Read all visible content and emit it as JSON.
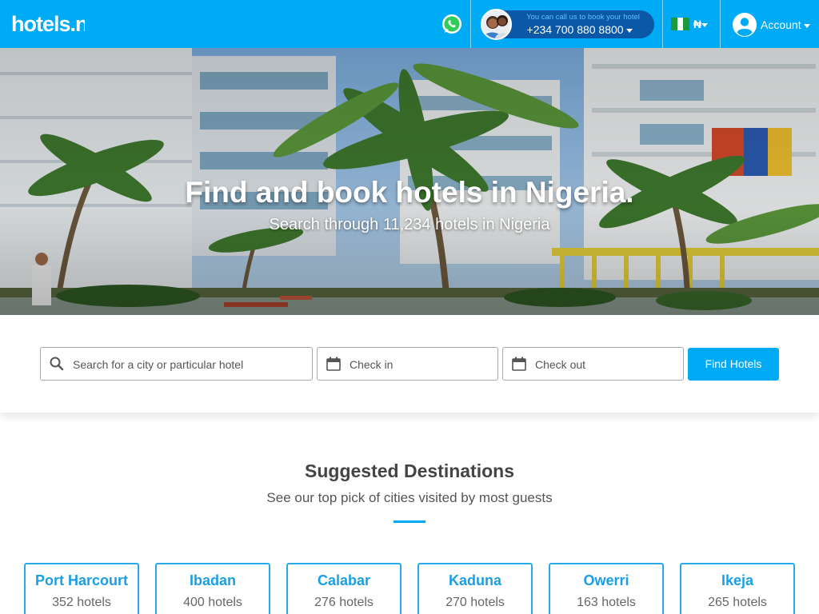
{
  "header": {
    "logo_text": "hotels.ng",
    "whatsapp_icon": "whatsapp-icon",
    "call_prompt": "You can call us to book your hotel",
    "phone": "+234 700 880 8800",
    "currency": "₦",
    "account_label": "Account",
    "brand_color": "#00aaf5",
    "pill_color": "#0b58a6"
  },
  "hero": {
    "title": "Find and book hotels in Nigeria.",
    "subtitle": "Search through 11,234 hotels in Nigeria"
  },
  "search": {
    "destination_placeholder": "Search for a city or particular hotel",
    "checkin_placeholder": "Check in",
    "checkout_placeholder": "Check out",
    "submit_label": "Find Hotels"
  },
  "destinations": {
    "title": "Suggested Destinations",
    "subtitle": "See our top pick of cities visited by most guests",
    "items": [
      {
        "city": "Port Harcourt",
        "count": "352 hotels"
      },
      {
        "city": "Ibadan",
        "count": "400 hotels"
      },
      {
        "city": "Calabar",
        "count": "276 hotels"
      },
      {
        "city": "Kaduna",
        "count": "270 hotels"
      },
      {
        "city": "Owerri",
        "count": "163 hotels"
      },
      {
        "city": "Ikeja",
        "count": "265 hotels"
      }
    ]
  }
}
